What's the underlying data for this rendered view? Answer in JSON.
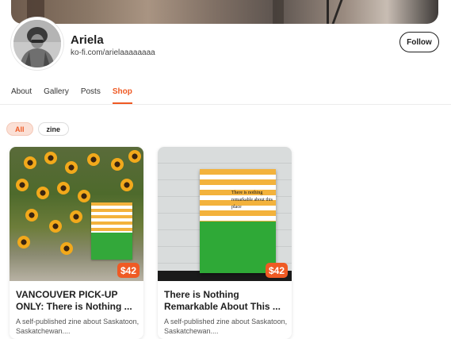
{
  "profile": {
    "name": "Ariela",
    "url": "ko-fi.com/arielaaaaaaaa",
    "follow_label": "Follow"
  },
  "tabs": [
    {
      "label": "About"
    },
    {
      "label": "Gallery"
    },
    {
      "label": "Posts"
    },
    {
      "label": "Shop",
      "active": true
    }
  ],
  "filters": [
    {
      "label": "All",
      "active": true
    },
    {
      "label": "zine"
    }
  ],
  "products": [
    {
      "price": "$42",
      "title": "VANCOUVER PICK-UP ONLY: There is Nothing ...",
      "description": "A self-published zine about Saskatoon, Saskatchewan...."
    },
    {
      "price": "$42",
      "title": "There is Nothing Remarkable About This ...",
      "description": "A self-published zine about Saskatoon, Saskatchewan....",
      "cover_text": "There is nothing remarkable about this place"
    }
  ],
  "colors": {
    "accent": "#ef5a24",
    "accent_soft": "#fbe0d6",
    "text": "#1f1f1f"
  }
}
